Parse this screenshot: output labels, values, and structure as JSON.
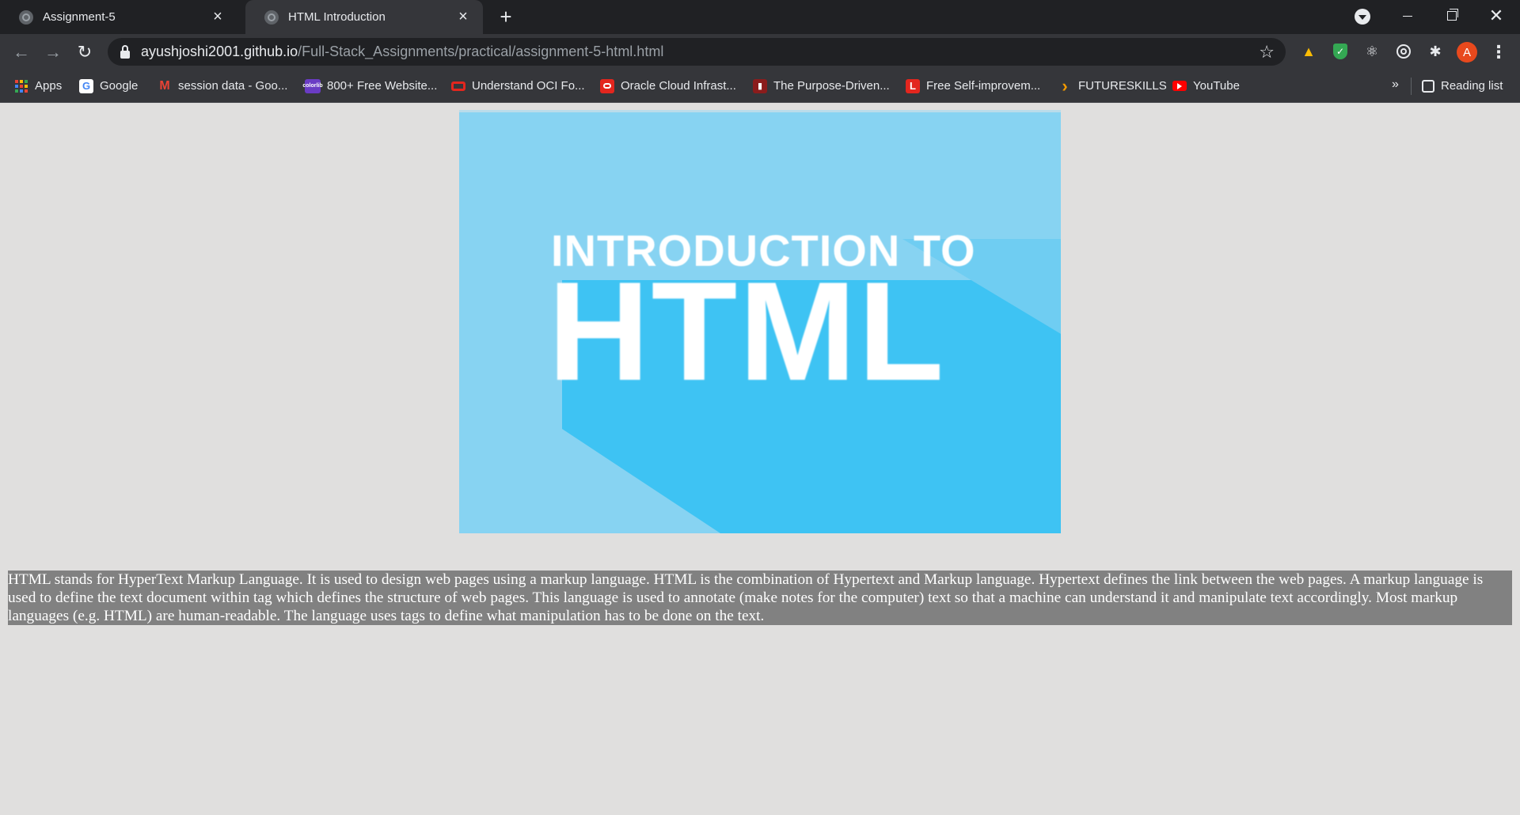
{
  "browser": {
    "tabs": [
      {
        "title": "Assignment-5",
        "active": false
      },
      {
        "title": "HTML Introduction",
        "active": true
      }
    ],
    "url_host": "ayushjoshi2001.github.io",
    "url_path": "/Full-Stack_Assignments/practical/assignment-5-html.html",
    "profile_initial": "A",
    "bookmarks": [
      {
        "label": "Apps",
        "icon": "apps-grid-icon"
      },
      {
        "label": "Google",
        "icon": "google-icon"
      },
      {
        "label": "session data - Goo...",
        "icon": "gmail-icon"
      },
      {
        "label": "800+ Free Website...",
        "icon": "colorlib-icon"
      },
      {
        "label": "Understand OCI Fo...",
        "icon": "oracle-icon"
      },
      {
        "label": "Oracle Cloud Infrast...",
        "icon": "oracle-icon"
      },
      {
        "label": "The Purpose-Driven...",
        "icon": "book-icon"
      },
      {
        "label": "Free Self-improvem...",
        "icon": "l-logo-icon"
      },
      {
        "label": "FUTURESKILLS",
        "icon": "chevron-icon"
      },
      {
        "label": "YouTube",
        "icon": "youtube-icon"
      }
    ],
    "bookmarks_overflow": "»",
    "reading_list": "Reading list"
  },
  "page": {
    "hero_image": {
      "line1": "INTRODUCTION TO",
      "line2": "HTML",
      "colors": {
        "background": "#87d3f2",
        "shadow": "#3ec3f3",
        "text": "#ffffff"
      }
    },
    "description": "HTML stands for HyperText Markup Language. It is used to design web pages using a markup language. HTML is the combination of Hypertext and Markup language. Hypertext defines the link between the web pages. A markup language is used to define the text document within tag which defines the structure of web pages. This language is used to annotate (make notes for the computer) text so that a machine can understand it and manipulate text accordingly. Most markup languages (e.g. HTML) are human-readable. The language uses tags to define what manipulation has to be done on the text."
  }
}
